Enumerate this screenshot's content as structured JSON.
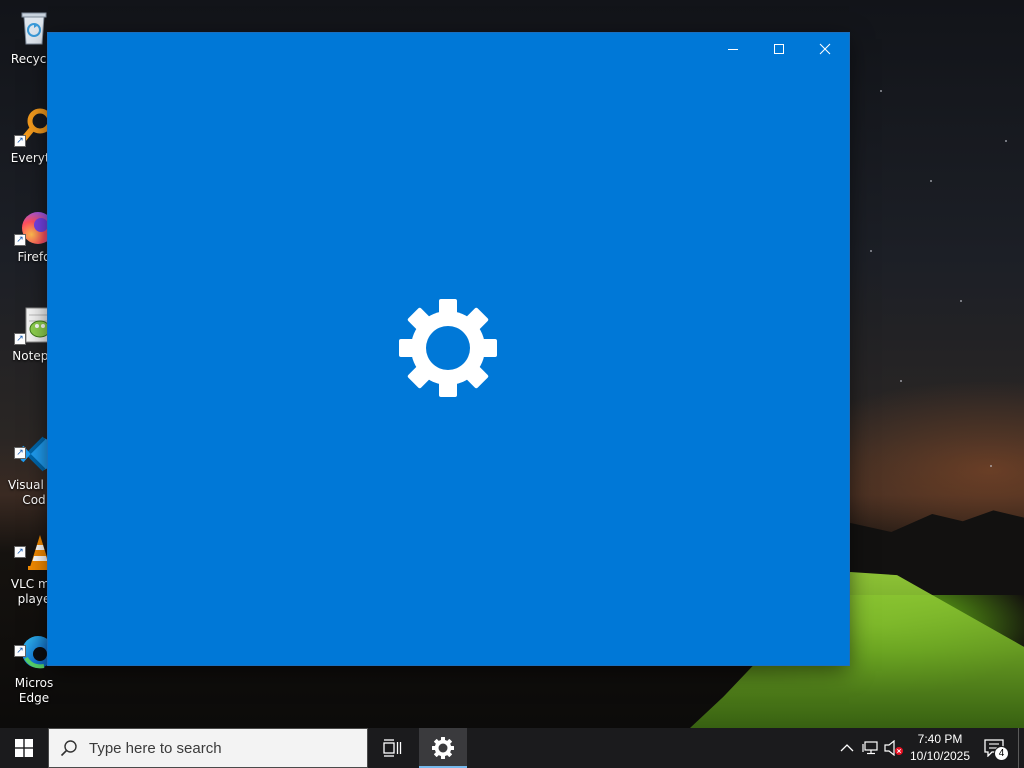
{
  "desktop": {
    "icons": [
      {
        "label": "Recycle",
        "icon": "recycle-bin-icon"
      },
      {
        "label": "Everyth",
        "icon": "everything-search-icon"
      },
      {
        "label": "Firefo",
        "icon": "firefox-icon"
      },
      {
        "label": "Notepa",
        "icon": "notepad-plus-plus-icon"
      },
      {
        "label": "Visual St\nCod",
        "icon": "vscode-icon"
      },
      {
        "label": "VLC me\nplaye",
        "icon": "vlc-icon"
      },
      {
        "label": "Micros\nEdge",
        "icon": "edge-icon"
      }
    ]
  },
  "window": {
    "app_icon": "gear-icon",
    "background_color": "#0078d7",
    "controls": {
      "minimize": "minimize-icon",
      "maximize": "maximize-icon",
      "close": "close-icon"
    }
  },
  "taskbar": {
    "start_icon": "windows-logo-icon",
    "search_placeholder": "Type here to search",
    "taskview_icon": "task-view-icon",
    "pinned_active_icon": "gear-icon",
    "tray": {
      "time": "7:40 PM",
      "date": "10/10/2025",
      "notification_count": "4"
    }
  }
}
